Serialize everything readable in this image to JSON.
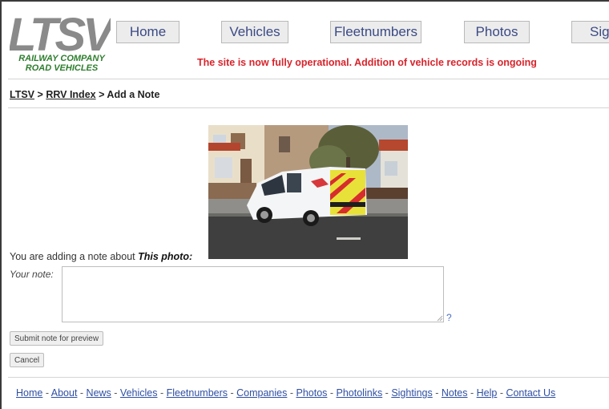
{
  "brand": {
    "logo_text": "LTSV",
    "tagline_line1": "RAILWAY COMPANY",
    "tagline_line2": "ROAD VEHICLES"
  },
  "nav": {
    "items": [
      {
        "label": "Home"
      },
      {
        "label": "Vehicles"
      },
      {
        "label": "Fleetnumbers"
      },
      {
        "label": "Photos"
      },
      {
        "label": "Sight"
      }
    ]
  },
  "notice": "The site is now fully operational. Addition of vehicle records is ongoing",
  "breadcrumb": {
    "items": [
      {
        "label": "LTSV"
      },
      {
        "label": "RRV Index"
      }
    ],
    "separator": ">",
    "current": "Add a Note"
  },
  "note_form": {
    "intro_text": "You are adding a note about",
    "subject": "This photo:",
    "field_label": "Your note:",
    "field_value": "",
    "help_link": "?",
    "submit_label": "Submit note for preview",
    "cancel_label": "Cancel"
  },
  "footer": {
    "separator": " - ",
    "links": [
      {
        "label": "Home"
      },
      {
        "label": "About"
      },
      {
        "label": "News"
      },
      {
        "label": "Vehicles"
      },
      {
        "label": "Fleetnumbers"
      },
      {
        "label": "Companies"
      },
      {
        "label": "Photos"
      },
      {
        "label": "Photolinks"
      },
      {
        "label": "Sightings"
      },
      {
        "label": "Notes"
      },
      {
        "label": "Help"
      },
      {
        "label": "Contact Us"
      }
    ]
  },
  "colors": {
    "logo_grey": "#8a8a8a",
    "tagline_green": "#2d7d2d",
    "notice_red": "#d8242c",
    "link_blue": "#2f4fa3",
    "nav_text": "#3b4a85"
  }
}
